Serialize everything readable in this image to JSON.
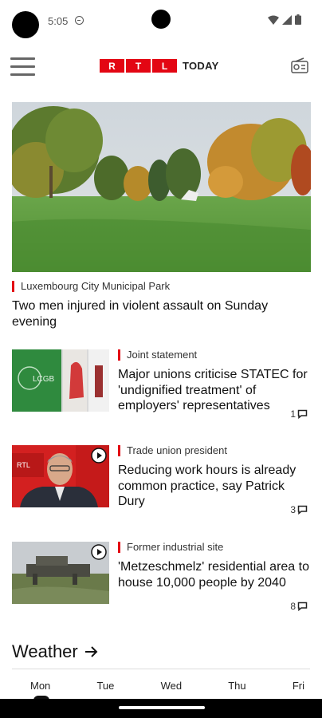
{
  "status_bar": {
    "time": "5:05"
  },
  "header": {
    "logo_letters": [
      "R",
      "T",
      "L"
    ],
    "logo_suffix": "TODAY",
    "menu_icon": "hamburger-menu-icon",
    "radio_icon": "radio-icon"
  },
  "colors": {
    "brand_red": "#e30613",
    "kicker_bar": "#e30613"
  },
  "hero": {
    "kicker": "Luxembourg City Municipal Park",
    "title": "Two men injured in violent assault on Sunday evening"
  },
  "articles": [
    {
      "kicker": "Joint statement",
      "title": "Major unions criticise STATEC for 'undignified treatment' of employers' representatives",
      "comments": "1",
      "video": false
    },
    {
      "kicker": "Trade union president",
      "title": "Reducing work hours is already common practice, say Patrick Dury",
      "comments": "3",
      "video": true
    },
    {
      "kicker": "Former industrial site",
      "title": "'Metzeschmelz' residential area to house 10,000 people by 2040",
      "comments": "8",
      "video": true
    }
  ],
  "weather": {
    "heading": "Weather",
    "days": [
      "Mon",
      "Tue",
      "Wed",
      "Thu",
      "Fri"
    ]
  }
}
